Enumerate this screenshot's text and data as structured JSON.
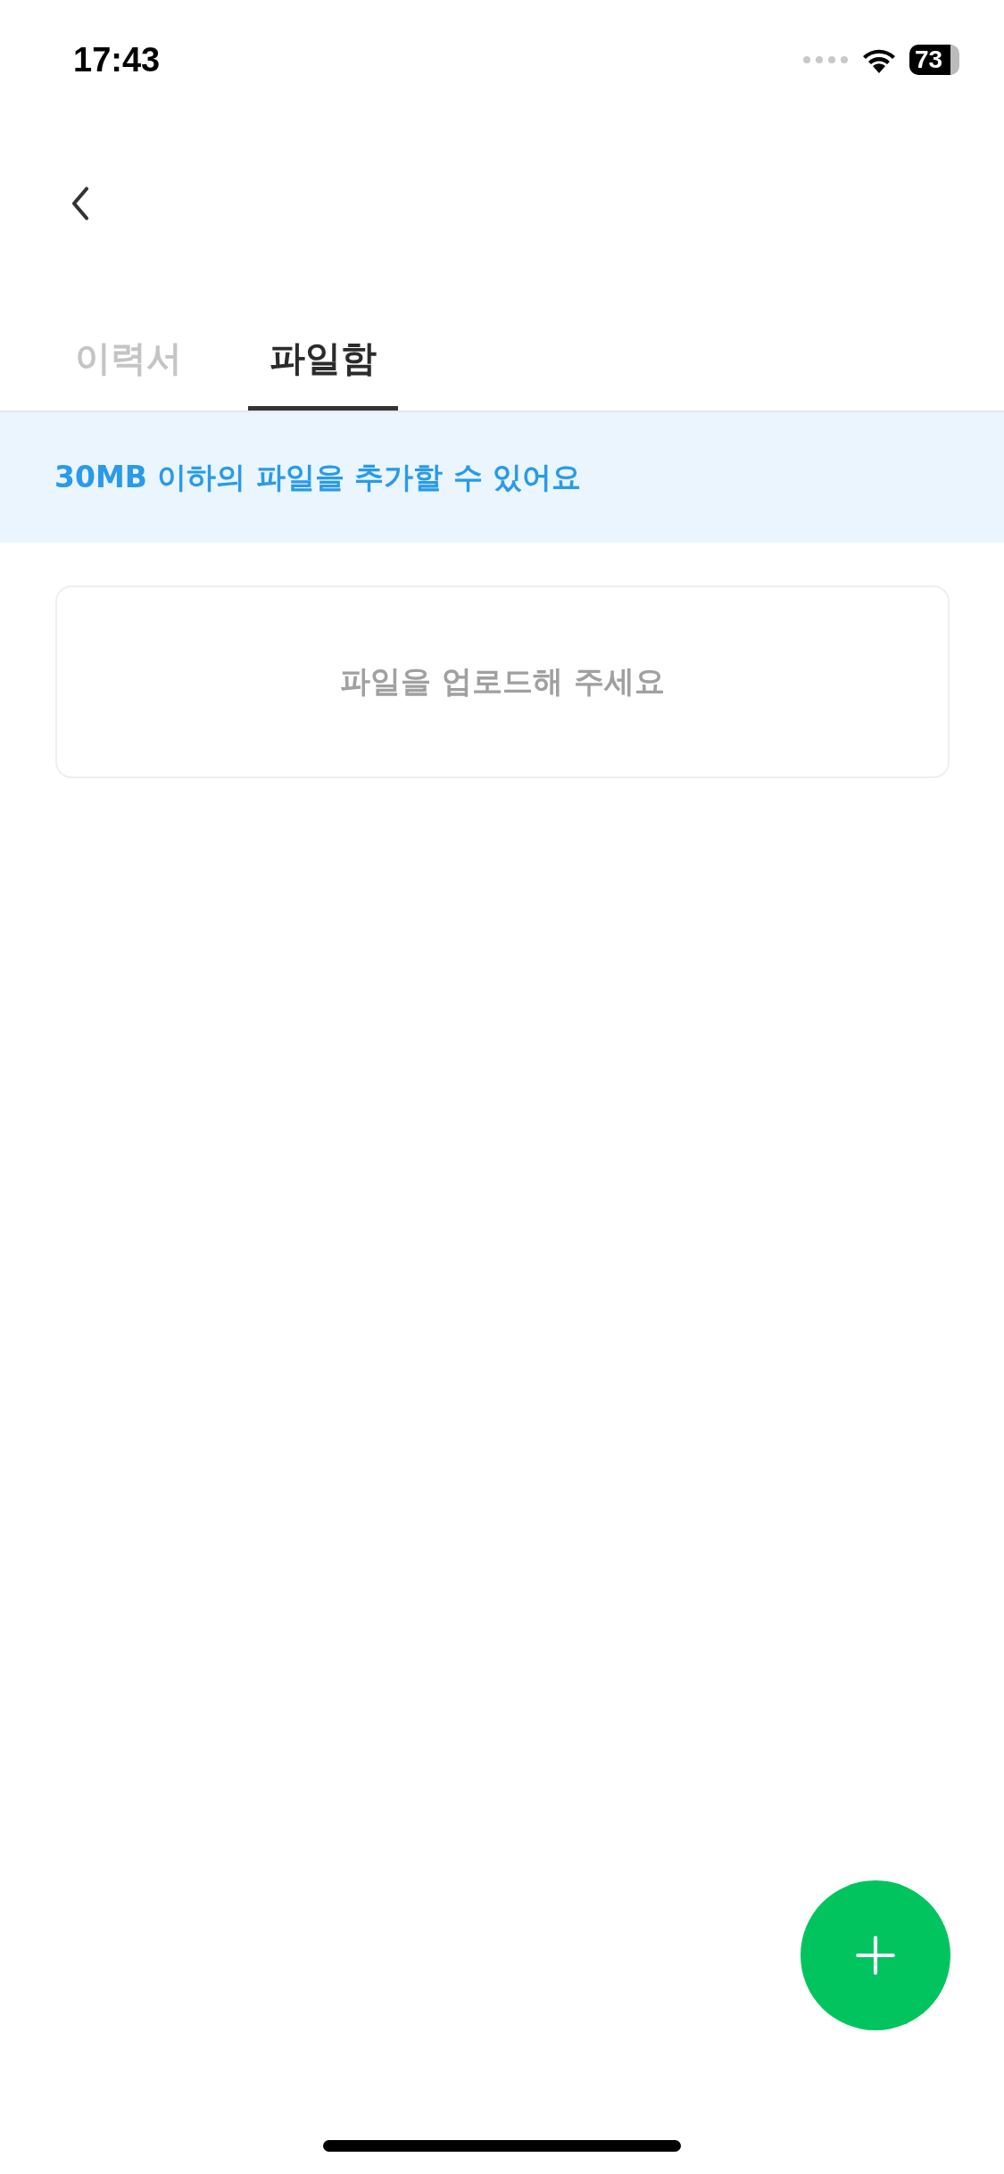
{
  "status_bar": {
    "time": "17:43",
    "battery": "73"
  },
  "tabs": [
    {
      "label": "이력서",
      "selected": false
    },
    {
      "label": "파일함",
      "selected": true
    }
  ],
  "notice": "30MB 이하의 파일을 추가할 수 있어요",
  "empty_card": {
    "message": "파일을 업로드해 주세요"
  }
}
